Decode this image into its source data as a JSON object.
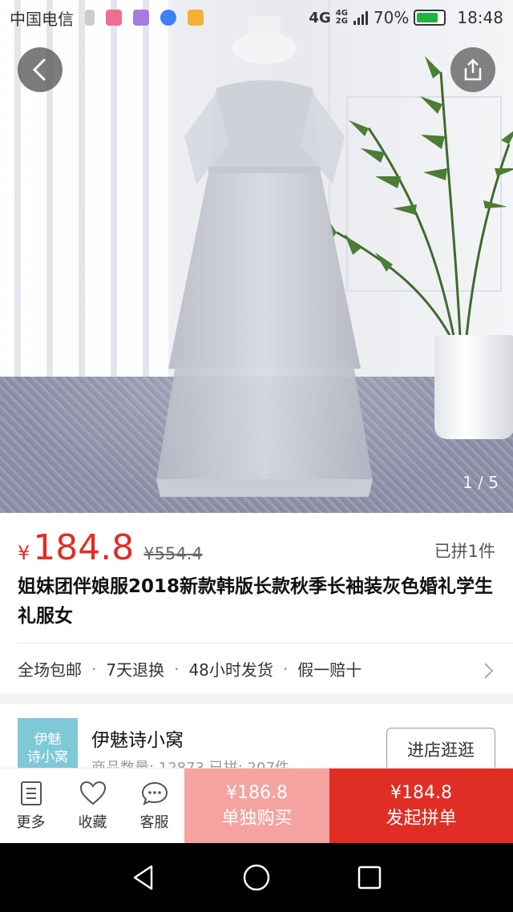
{
  "status_bar": {
    "carrier": "中国电信",
    "network": "4G",
    "network_small_top": "4G",
    "network_small_bottom": "2G",
    "battery": "70%",
    "time": "18:48"
  },
  "hero": {
    "image_counter": "1 / 5",
    "back_icon": "chevron-left-icon",
    "share_icon": "share-icon"
  },
  "product": {
    "currency": "¥",
    "price": "184.8",
    "original_price": "¥554.4",
    "sold": "已拼1件",
    "title": "姐妹团伴娘服2018新款韩版长款秋季长袖装灰色婚礼学生礼服女",
    "services": [
      "全场包邮",
      "7天退换",
      "48小时发货",
      "假一赔十"
    ]
  },
  "store": {
    "logo_text_line1": "伊魅",
    "logo_text_line2": "诗小窝",
    "name": "伊魅诗小窝",
    "meta": "商品数量: 12873    已拼: 207件",
    "enter_label": "进店逛逛"
  },
  "actions": {
    "more": "更多",
    "favorite": "收藏",
    "service": "客服",
    "solo_price": "¥186.8",
    "solo_label": "单独购买",
    "group_price": "¥184.8",
    "group_label": "发起拼单"
  },
  "colors": {
    "accent": "#e02e24",
    "solo_bg": "#f5a3a0",
    "store_logo_bg": "#7fc9d6"
  }
}
